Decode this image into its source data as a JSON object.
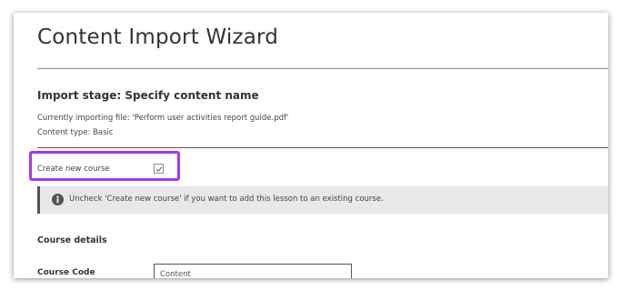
{
  "page": {
    "title": "Content Import Wizard"
  },
  "stage": {
    "heading": "Import stage: Specify content name",
    "file_line": "Currently importing file: 'Perform user activities report guide.pdf'",
    "type_line": "Content type: Basic"
  },
  "create_course": {
    "label": "Create new course",
    "checked": true
  },
  "info": {
    "icon": "info-icon",
    "text": "Uncheck 'Create new course' if you want to add this lesson to an existing course."
  },
  "course_details": {
    "heading": "Course details",
    "code_label": "Course Code",
    "code_value": "Content"
  },
  "colors": {
    "highlight": "#a23be6",
    "info_bar": "#e8e8e8",
    "text": "#333333"
  }
}
